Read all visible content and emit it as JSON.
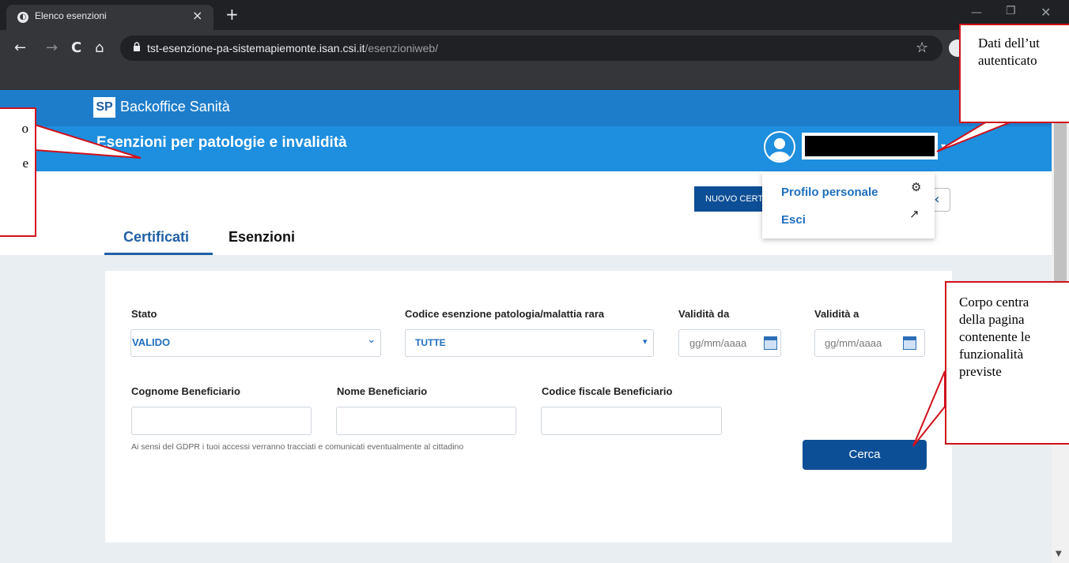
{
  "browser": {
    "tab_title": "Elenco esenzioni",
    "tab_close": "×",
    "new_tab": "+",
    "url_domain": "tst-esenzione-pa-sistemapiemonte.isan.csi.it",
    "url_path": "/esenzioniweb/",
    "back": "←",
    "forward": "→",
    "reload": "C",
    "home": "⌂",
    "star": "☆",
    "min": "—",
    "max": "❐",
    "close": "✕"
  },
  "app": {
    "logo": "SP",
    "title": "Backoffice Sanità",
    "page_title": "Esenzioni per patologie e invalidità",
    "user_caret": "▾"
  },
  "actions": {
    "nuovo_label": "NUOVO CERTIFICATO",
    "back_arrow": "‹"
  },
  "user_menu": {
    "items": [
      {
        "label": "Profilo personale",
        "icon": "gear-icon",
        "glyph": "⚙"
      },
      {
        "label": "Esci",
        "icon": "external-link-icon",
        "glyph": "↗"
      }
    ]
  },
  "tabs": [
    {
      "label": "Certificati",
      "active": true
    },
    {
      "label": "Esenzioni",
      "active": false
    }
  ],
  "form": {
    "stato_label": "Stato",
    "stato_value": "VALIDO",
    "codice_label": "Codice esenzione patologia/malattia rara",
    "codice_value": "TUTTE",
    "validita_da_label": "Validità da",
    "validita_a_label": "Validità a",
    "date_placeholder": "gg/mm/aaaa",
    "cognome_label": "Cognome Beneficiario",
    "nome_label": "Nome Beneficiario",
    "cf_label": "Codice fiscale Beneficiario",
    "gdpr_note": "Ai sensi del GDPR i tuoi accessi verranno tracciati e comunicati eventualmente al cittadino",
    "search_button": "Cerca",
    "chevron": "⌄",
    "select_arrow": "▾"
  },
  "callouts": {
    "header_lines": [
      "o",
      "",
      "e"
    ],
    "user_lines": [
      "Dati dell’ut",
      "autenticato"
    ],
    "body_lines": [
      "Corpo centra",
      "della pagina",
      "contenente le",
      "funzionalità",
      "previste"
    ]
  },
  "colors": {
    "brand_blue": "#1e7dcb",
    "header_blue": "#1e8ede",
    "button_blue": "#0d4f96",
    "callout_red": "#d0101a"
  }
}
